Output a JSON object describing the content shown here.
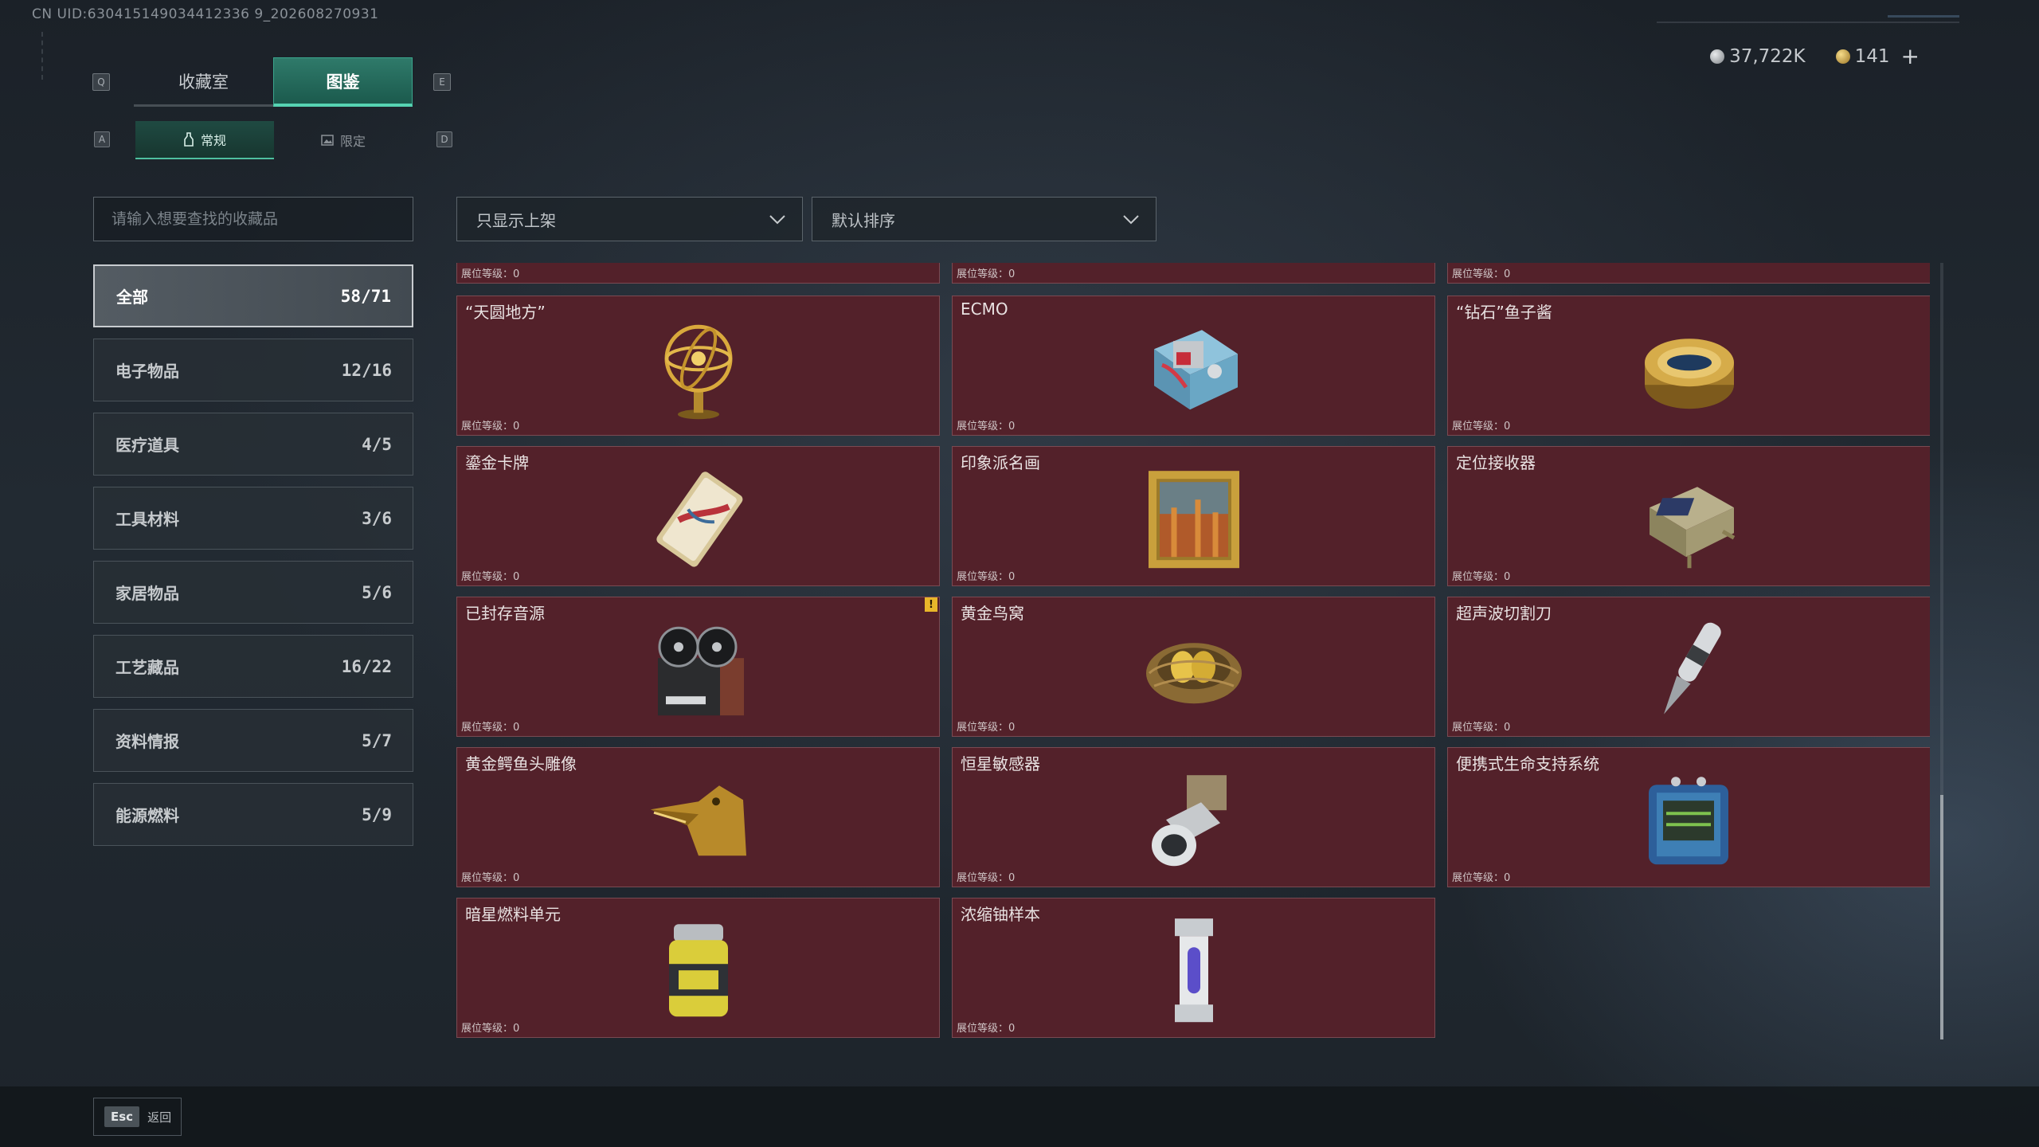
{
  "uid_text": "CN UID:630415149034412336 9_202608270931",
  "currency": {
    "silver": "37,722K",
    "gold": "141",
    "add_symbol": "+"
  },
  "keys": {
    "q": "Q",
    "e": "E",
    "a": "A",
    "d": "D"
  },
  "tabs": [
    {
      "label": "收藏室"
    },
    {
      "label": "图鉴"
    }
  ],
  "subtabs": [
    {
      "label": "常规"
    },
    {
      "label": "限定"
    }
  ],
  "search": {
    "placeholder": "请输入想要查找的收藏品"
  },
  "filters": {
    "shelf": "只显示上架",
    "sort": "默认排序"
  },
  "categories": [
    {
      "label": "全部",
      "count": "58/71"
    },
    {
      "label": "电子物品",
      "count": "12/16"
    },
    {
      "label": "医疗道具",
      "count": "4/5"
    },
    {
      "label": "工具材料",
      "count": "3/6"
    },
    {
      "label": "家居物品",
      "count": "5/6"
    },
    {
      "label": "工艺藏品",
      "count": "16/22"
    },
    {
      "label": "资料情报",
      "count": "5/7"
    },
    {
      "label": "能源燃料",
      "count": "5/9"
    }
  ],
  "level_label": "展位等级：0",
  "items": [
    {
      "name": "",
      "icon": "partial-item"
    },
    {
      "name": "",
      "icon": "partial-item"
    },
    {
      "name": "",
      "icon": "partial-item"
    },
    {
      "name": "“天圆地方”",
      "icon": "armillary-sphere-icon"
    },
    {
      "name": "ECMO",
      "icon": "ecmo-machine-icon"
    },
    {
      "name": "“钻石”鱼子酱",
      "icon": "caviar-tin-icon"
    },
    {
      "name": "鎏金卡牌",
      "icon": "gilded-card-icon"
    },
    {
      "name": "印象派名画",
      "icon": "framed-painting-icon"
    },
    {
      "name": "定位接收器",
      "icon": "locator-receiver-icon"
    },
    {
      "name": "已封存音源",
      "icon": "reel-tape-recorder-icon",
      "badge": "!"
    },
    {
      "name": "黄金鸟窝",
      "icon": "golden-nest-icon"
    },
    {
      "name": "超声波切割刀",
      "icon": "ultrasonic-knife-icon"
    },
    {
      "name": "黄金鳄鱼头雕像",
      "icon": "golden-crocodile-icon"
    },
    {
      "name": "恒星敏感器",
      "icon": "star-sensor-icon"
    },
    {
      "name": "便携式生命支持系统",
      "icon": "life-support-icon"
    },
    {
      "name": "暗星燃料单元",
      "icon": "fuel-canister-icon"
    },
    {
      "name": "浓缩铀样本",
      "icon": "uranium-sample-icon"
    }
  ],
  "esc": {
    "key": "Esc",
    "label": "返回"
  },
  "colors": {
    "card_bg": "#53212a",
    "accent": "#56d3b2",
    "badge": "#e8b62a"
  }
}
